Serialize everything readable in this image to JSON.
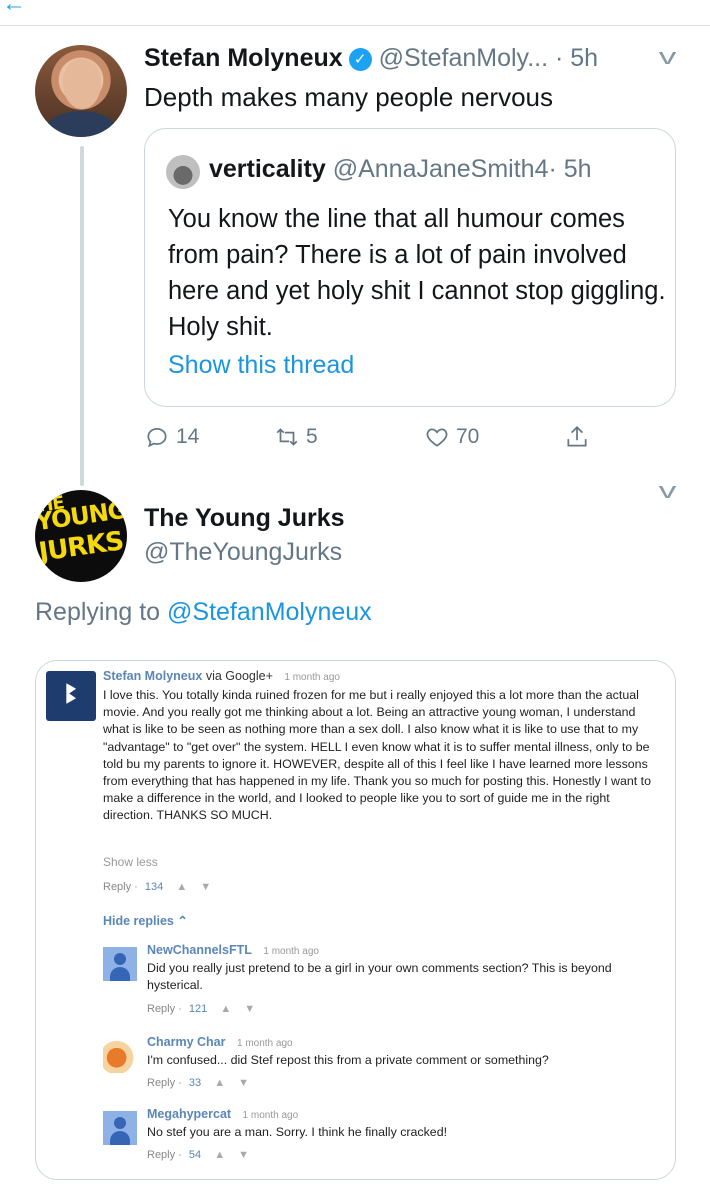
{
  "tweet": {
    "name": "Stefan Molyneux",
    "handle": "@StefanMoly...",
    "time": "· 5h",
    "text": "Depth makes many people nervous"
  },
  "quote": {
    "name": "verticality",
    "handle": "@AnnaJaneSmith4",
    "time": "· 5h",
    "text": "You know the line that all humour comes from pain? There is a lot of pain involved here and yet holy shit I cannot stop giggling. Holy shit.",
    "show_thread": "Show this thread"
  },
  "actions": {
    "replies": "14",
    "retweets": "5",
    "likes": "70"
  },
  "reply_tweet": {
    "name": "The Young Jurks",
    "handle": "@TheYoungJurks",
    "replying_prefix": "Replying to",
    "replying_to": "@StefanMolyneux",
    "avatar_text_1": "YOUNG",
    "avatar_text_2": "JURKS",
    "avatar_text_0": "HE"
  },
  "youtube": {
    "main": {
      "author": "Stefan Molyneux",
      "via": "via Google+",
      "time": "1 month ago",
      "body": "I love this. You totally kinda ruined frozen for me but i really enjoyed this a lot more than the actual movie. And you really got me thinking about a lot. Being an attractive young woman, I understand what is like to be seen as nothing more than a sex doll. I also know what it is like to use that to my \"advantage\" to \"get over\" the system. HELL I even know what it is to suffer mental illness, only to be told bu my parents to ignore it. HOWEVER, despite all of this I feel like I have learned more lessons from everything that has happened in my life. Thank you so much for posting this. Honestly I want to make a difference in the world, and I looked to people like you to sort of guide me in the right direction. THANKS SO MUCH.",
      "show_less": "Show less",
      "reply_label": "Reply",
      "likes": "134"
    },
    "hide_replies": "Hide replies",
    "replies": [
      {
        "author": "NewChannelsFTL",
        "time": "1 month ago",
        "body": "Did you really just pretend to be a girl in your own comments section? This is beyond hysterical.",
        "reply_label": "Reply",
        "likes": "121"
      },
      {
        "author": "Charmy Char",
        "time": "1 month ago",
        "body": "I'm confused... did Stef repost this from a private comment or something?",
        "reply_label": "Reply",
        "likes": "33"
      },
      {
        "author": "Megahypercat",
        "time": "1 month ago",
        "body": "No stef you are a man. Sorry. I think he finally cracked!",
        "reply_label": "Reply",
        "likes": "54"
      }
    ]
  }
}
